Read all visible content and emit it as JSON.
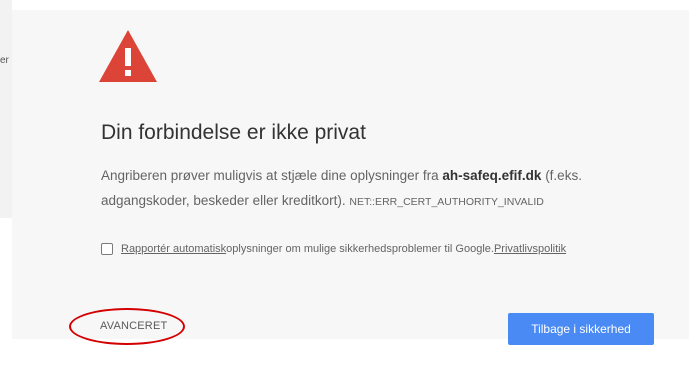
{
  "background": {
    "snippet": "er"
  },
  "interstitial": {
    "icon": "warning-triangle-icon",
    "heading": "Din forbindelse er ikke privat",
    "body_before_host": "Angriberen prøver muligvis at stjæle dine oplysninger fra ",
    "host": "ah-safeq.efif.dk",
    "body_after_host": " (f.eks. adgangskoder, beskeder eller kreditkort). ",
    "error_code": "NET::ERR_CERT_AUTHORITY_INVALID",
    "report": {
      "checked": false,
      "link_label": "Rapportér automatisk",
      "text": " oplysninger om mulige sikkerhedsproblemer til Google. ",
      "privacy_link": "Privatlivspolitik"
    },
    "advanced_label": "AVANCERET",
    "back_button_label": "Tilbage i sikkerhed"
  },
  "colors": {
    "warning_red": "#db4437",
    "button_blue": "#4a8af4",
    "annotation_red": "#d40000",
    "panel_bg": "#f7f7f7"
  }
}
